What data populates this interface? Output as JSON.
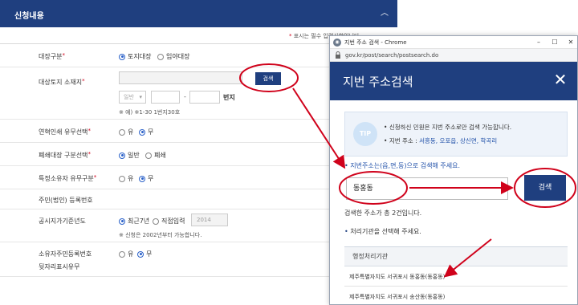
{
  "form": {
    "header_title": "신청내용",
    "collapse_icon": "chevron-up-icon",
    "required_note": "표시는 필수 입력사항입니다",
    "rows": [
      {
        "label": "대장구분",
        "required": true,
        "options": [
          "토지대장",
          "임야대장"
        ],
        "selected": 0
      },
      {
        "label": "대상토지 소재지",
        "required": true,
        "search_button": "검색",
        "lot_type_select": "일반",
        "bunji_label": "번지",
        "dash": "-",
        "hint": "※ 예) ※1-30 1번지30호"
      },
      {
        "label": "연혁인쇄 유무선택",
        "required": true,
        "options": [
          "유",
          "무"
        ],
        "selected": 1
      },
      {
        "label": "폐쇄대장 구분선택",
        "required": true,
        "options": [
          "일반",
          "폐쇄"
        ],
        "selected": 0
      },
      {
        "label": "특정소유자 유무구분",
        "required": true,
        "options": [
          "유",
          "무"
        ],
        "selected": 1
      },
      {
        "label": "주민(법인) 등록번호",
        "required": false
      },
      {
        "label": "공시지가기준년도",
        "required": false,
        "options": [
          "최근7년",
          "직접입력"
        ],
        "selected": 0,
        "year_input": "2014",
        "hint": "※ 신청은 2002년부터 가능합니다."
      },
      {
        "label_line1": "소유자주민등록번호",
        "label_line2": "뒷자리표시유무",
        "required": false,
        "options": [
          "유",
          "무"
        ],
        "selected": 1
      }
    ]
  },
  "popup": {
    "window_title": "지번 주소 검색 - Chrome",
    "url": "gov.kr/post/search/postsearch.do",
    "window_buttons": [
      "–",
      "☐",
      "✕"
    ],
    "title": "지번 주소검색",
    "close_icon": "close-icon",
    "tip": {
      "icon_text": "TIP",
      "line1": "신청하신 민원은 지번 주소로만 검색 가능합니다.",
      "line2_prefix": "지번 주소 : ",
      "line2_examples": "서흥동, 오포읍, 상신면, 학곡리"
    },
    "instruction": "지번주소는(읍,면,동)으로 검색해 주세요.",
    "search_value": "동홍동",
    "search_button": "검색",
    "result_count": "검색한 주소가 총 2건입니다.",
    "select_agency": "처리기관을 선택해 주세요.",
    "table": {
      "header": "행정처리기관",
      "rows": [
        "제주특별자치도 서귀포시 동홍동(동홍동)",
        "제주특별자치도 서귀포시 송산동(동홍동)"
      ]
    }
  },
  "annotation_color": "#d0021b"
}
